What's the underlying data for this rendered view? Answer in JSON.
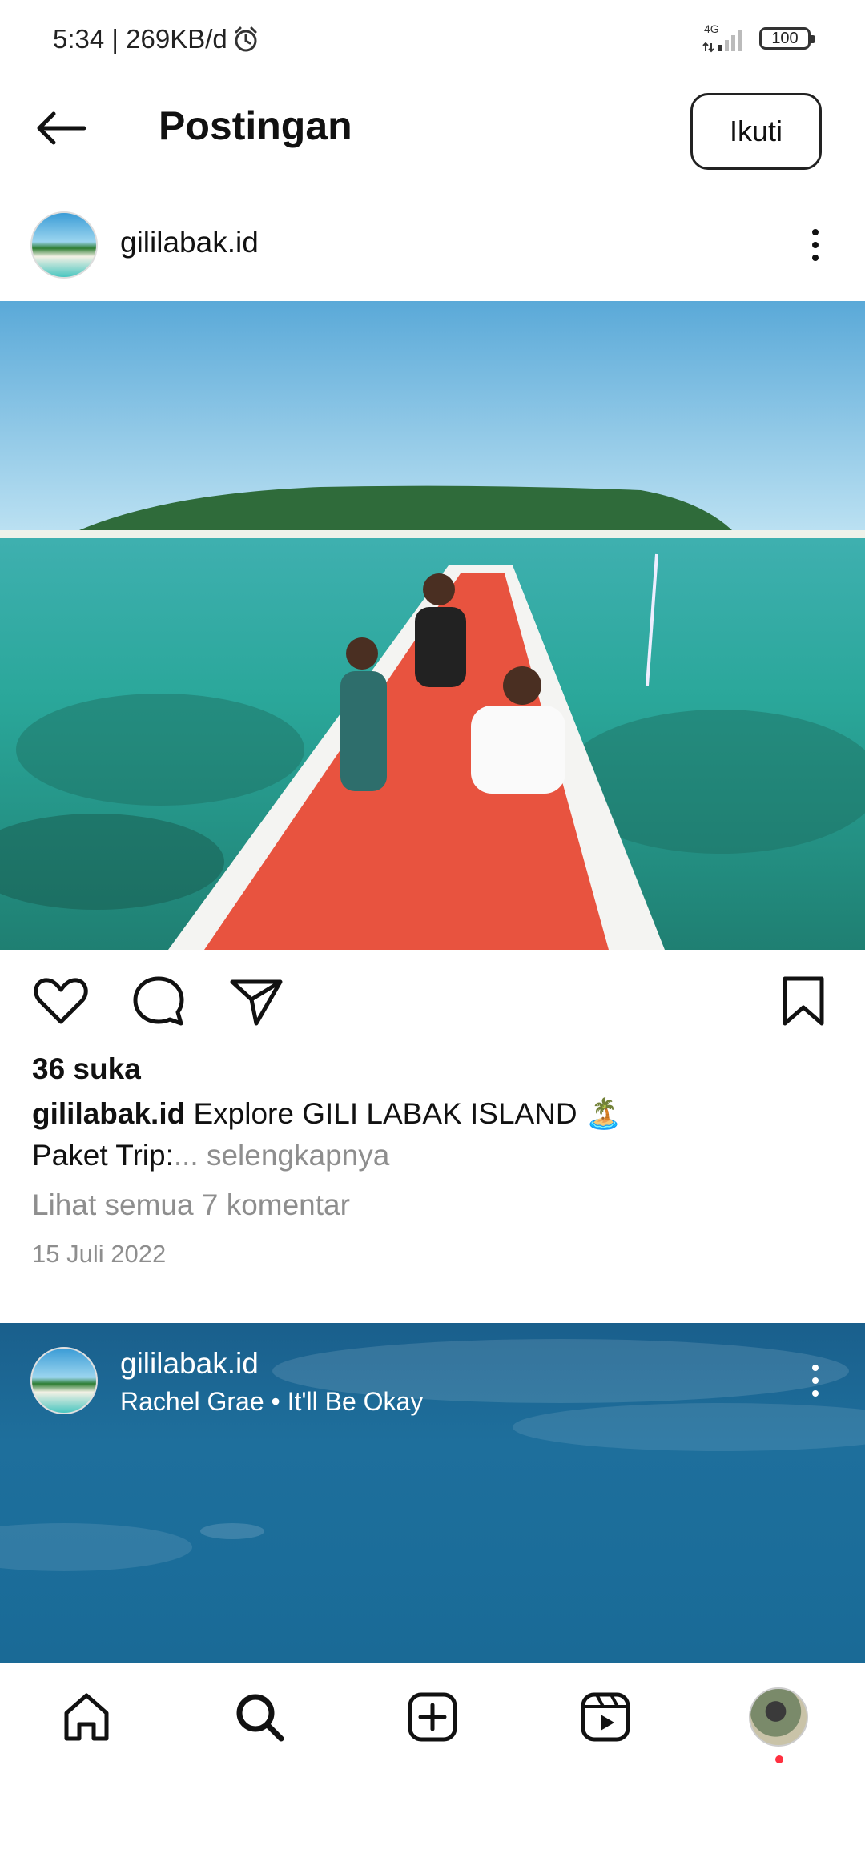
{
  "status_bar": {
    "time": "5:34 | 269KB/d",
    "network": "4G",
    "battery": "100"
  },
  "header": {
    "title": "Postingan",
    "follow_label": "Ikuti"
  },
  "post": {
    "username": "gililabak.id",
    "likes": "36 suka",
    "caption_user": "gililabak.id",
    "caption_text": "Explore  GILI LABAK ISLAND 🏝️",
    "caption_line2": "Paket Trip:",
    "caption_more": "... selengkapnya",
    "view_comments": "Lihat semua 7 komentar",
    "date": "15 Juli 2022"
  },
  "reel": {
    "username": "gililabak.id",
    "audio": "Rachel Grae • It'll Be Okay"
  },
  "icons": {
    "back": "arrow-left-icon",
    "more": "more-vertical-icon",
    "like": "heart-icon",
    "comment": "comment-icon",
    "share": "send-icon",
    "save": "bookmark-icon",
    "home": "home-icon",
    "search": "search-icon",
    "create": "plus-square-icon",
    "reels": "reels-icon"
  },
  "colors": {
    "secondary_text": "#8e8e8e",
    "notification_dot": "#ff3040"
  }
}
